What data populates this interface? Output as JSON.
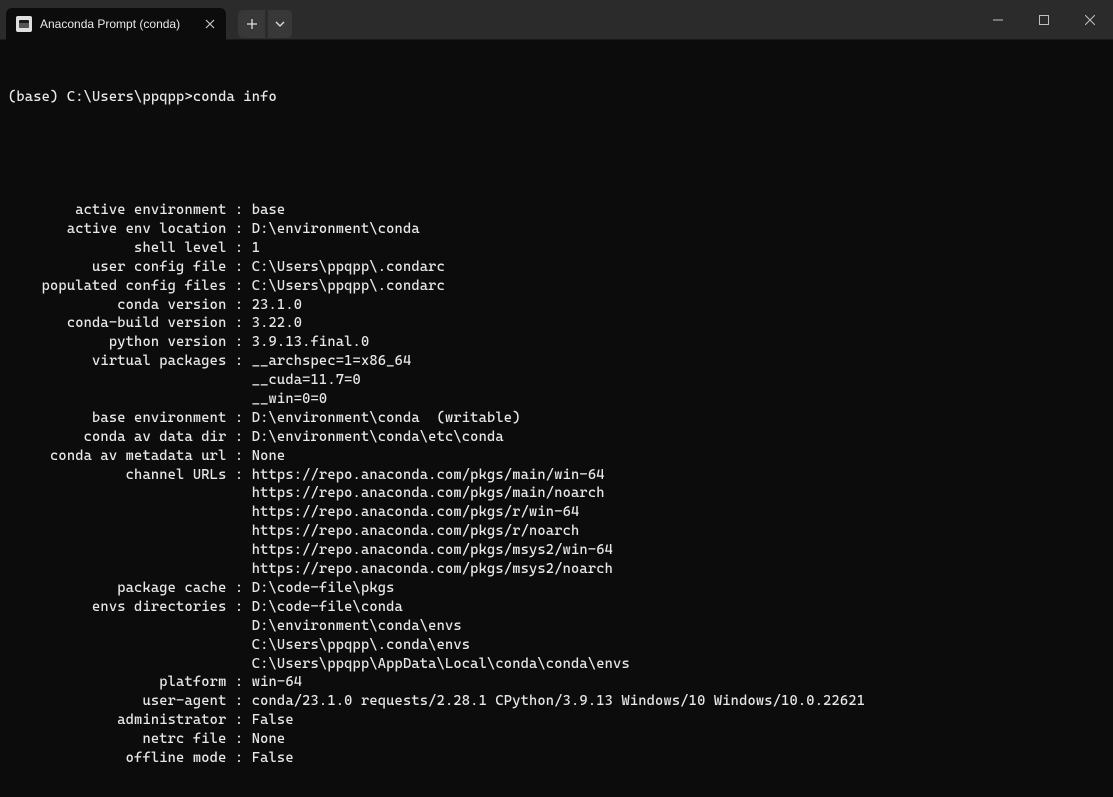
{
  "titlebar": {
    "tab_title": "Anaconda Prompt (conda)"
  },
  "prompt": "(base) C:\\Users\\ppqpp>conda info",
  "info": {
    "rows": [
      {
        "label": "active environment",
        "value": "base"
      },
      {
        "label": "active env location",
        "value": "D:\\environment\\conda"
      },
      {
        "label": "shell level",
        "value": "1"
      },
      {
        "label": "user config file",
        "value": "C:\\Users\\ppqpp\\.condarc"
      },
      {
        "label": "populated config files",
        "value": "C:\\Users\\ppqpp\\.condarc"
      },
      {
        "label": "conda version",
        "value": "23.1.0"
      },
      {
        "label": "conda-build version",
        "value": "3.22.0"
      },
      {
        "label": "python version",
        "value": "3.9.13.final.0"
      },
      {
        "label": "virtual packages",
        "value": "__archspec=1=x86_64",
        "cont": [
          "__cuda=11.7=0",
          "__win=0=0"
        ]
      },
      {
        "label": "base environment",
        "value": "D:\\environment\\conda  (writable)"
      },
      {
        "label": "conda av data dir",
        "value": "D:\\environment\\conda\\etc\\conda"
      },
      {
        "label": "conda av metadata url",
        "value": "None"
      },
      {
        "label": "channel URLs",
        "value": "https://repo.anaconda.com/pkgs/main/win-64",
        "cont": [
          "https://repo.anaconda.com/pkgs/main/noarch",
          "https://repo.anaconda.com/pkgs/r/win-64",
          "https://repo.anaconda.com/pkgs/r/noarch",
          "https://repo.anaconda.com/pkgs/msys2/win-64",
          "https://repo.anaconda.com/pkgs/msys2/noarch"
        ]
      },
      {
        "label": "package cache",
        "value": "D:\\code-file\\pkgs"
      },
      {
        "label": "envs directories",
        "value": "D:\\code-file\\conda",
        "cont": [
          "D:\\environment\\conda\\envs",
          "C:\\Users\\ppqpp\\.conda\\envs",
          "C:\\Users\\ppqpp\\AppData\\Local\\conda\\conda\\envs"
        ]
      },
      {
        "label": "platform",
        "value": "win-64"
      },
      {
        "label": "user-agent",
        "value": "conda/23.1.0 requests/2.28.1 CPython/3.9.13 Windows/10 Windows/10.0.22621"
      },
      {
        "label": "administrator",
        "value": "False"
      },
      {
        "label": "netrc file",
        "value": "None"
      },
      {
        "label": "offline mode",
        "value": "False"
      }
    ]
  }
}
